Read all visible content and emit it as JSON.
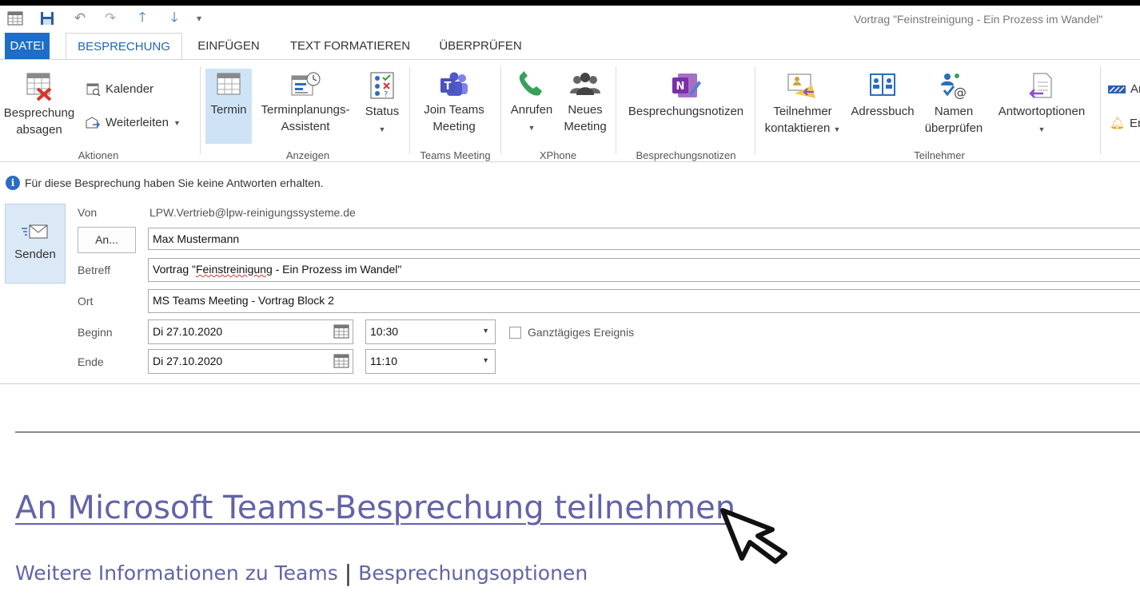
{
  "window": {
    "title": "Vortrag \"Feinstreinigung - Ein Prozess im Wandel\""
  },
  "tabs": [
    {
      "label": "DATEI"
    },
    {
      "label": "BESPRECHUNG"
    },
    {
      "label": "EINFÜGEN"
    },
    {
      "label": "TEXT FORMATIEREN"
    },
    {
      "label": "ÜBERPRÜFEN"
    }
  ],
  "ribbon": {
    "aktionen": {
      "cancel_line1": "Besprechung",
      "cancel_line2": "absagen",
      "kalender": "Kalender",
      "weiterleiten": "Weiterleiten",
      "label": "Aktionen"
    },
    "anzeigen": {
      "termin": "Termin",
      "assistent_line1": "Terminplanungs-",
      "assistent_line2": "Assistent",
      "status": "Status",
      "label": "Anzeigen"
    },
    "teams": {
      "line1": "Join Teams",
      "line2": "Meeting",
      "label": "Teams Meeting"
    },
    "xphone": {
      "anrufen": "Anrufen",
      "neues_line1": "Neues",
      "neues_line2": "Meeting",
      "label": "XPhone"
    },
    "notes": {
      "button": "Besprechungsnotizen",
      "label": "Besprechungsnotizen"
    },
    "teilnehmer": {
      "kontakt_line1": "Teilnehmer",
      "kontakt_line2": "kontaktieren",
      "adressbuch": "Adressbuch",
      "namen_line1": "Namen",
      "namen_line2": "überprüfen",
      "antwort": "Antwortoptionen",
      "label": "Teilnehmer"
    },
    "partial": {
      "item1": "An",
      "item2": "Er"
    }
  },
  "info_message": "Für diese Besprechung haben Sie keine Antworten erhalten.",
  "form": {
    "send_label": "Senden",
    "von_label": "Von",
    "von_value": "LPW.Vertrieb@lpw-reinigungssysteme.de",
    "an_button": "An...",
    "an_value": "Max Mustermann",
    "betreff_label": "Betreff",
    "betreff_pre": "Vortrag \"",
    "betreff_word": "Feinstreinigung",
    "betreff_post": " - Ein Prozess im Wandel\"",
    "ort_label": "Ort",
    "ort_value": "MS Teams Meeting -  Vortrag Block 2",
    "beginn_label": "Beginn",
    "beginn_date": "Di 27.10.2020",
    "beginn_time": "10:30",
    "allday_label": "Ganztägiges Ereignis",
    "ende_label": "Ende",
    "ende_date": "Di 27.10.2020",
    "ende_time": "11:10"
  },
  "body": {
    "join_link": "An Microsoft Teams-Besprechung teilnehmen",
    "info_link": "Weitere Informationen zu Teams",
    "separator": "|",
    "options_link": "Besprechungsoptionen"
  },
  "colors": {
    "accent": "#1e6ec7",
    "teams_purple": "#6264a7",
    "send_bg": "#dbe9f7"
  }
}
